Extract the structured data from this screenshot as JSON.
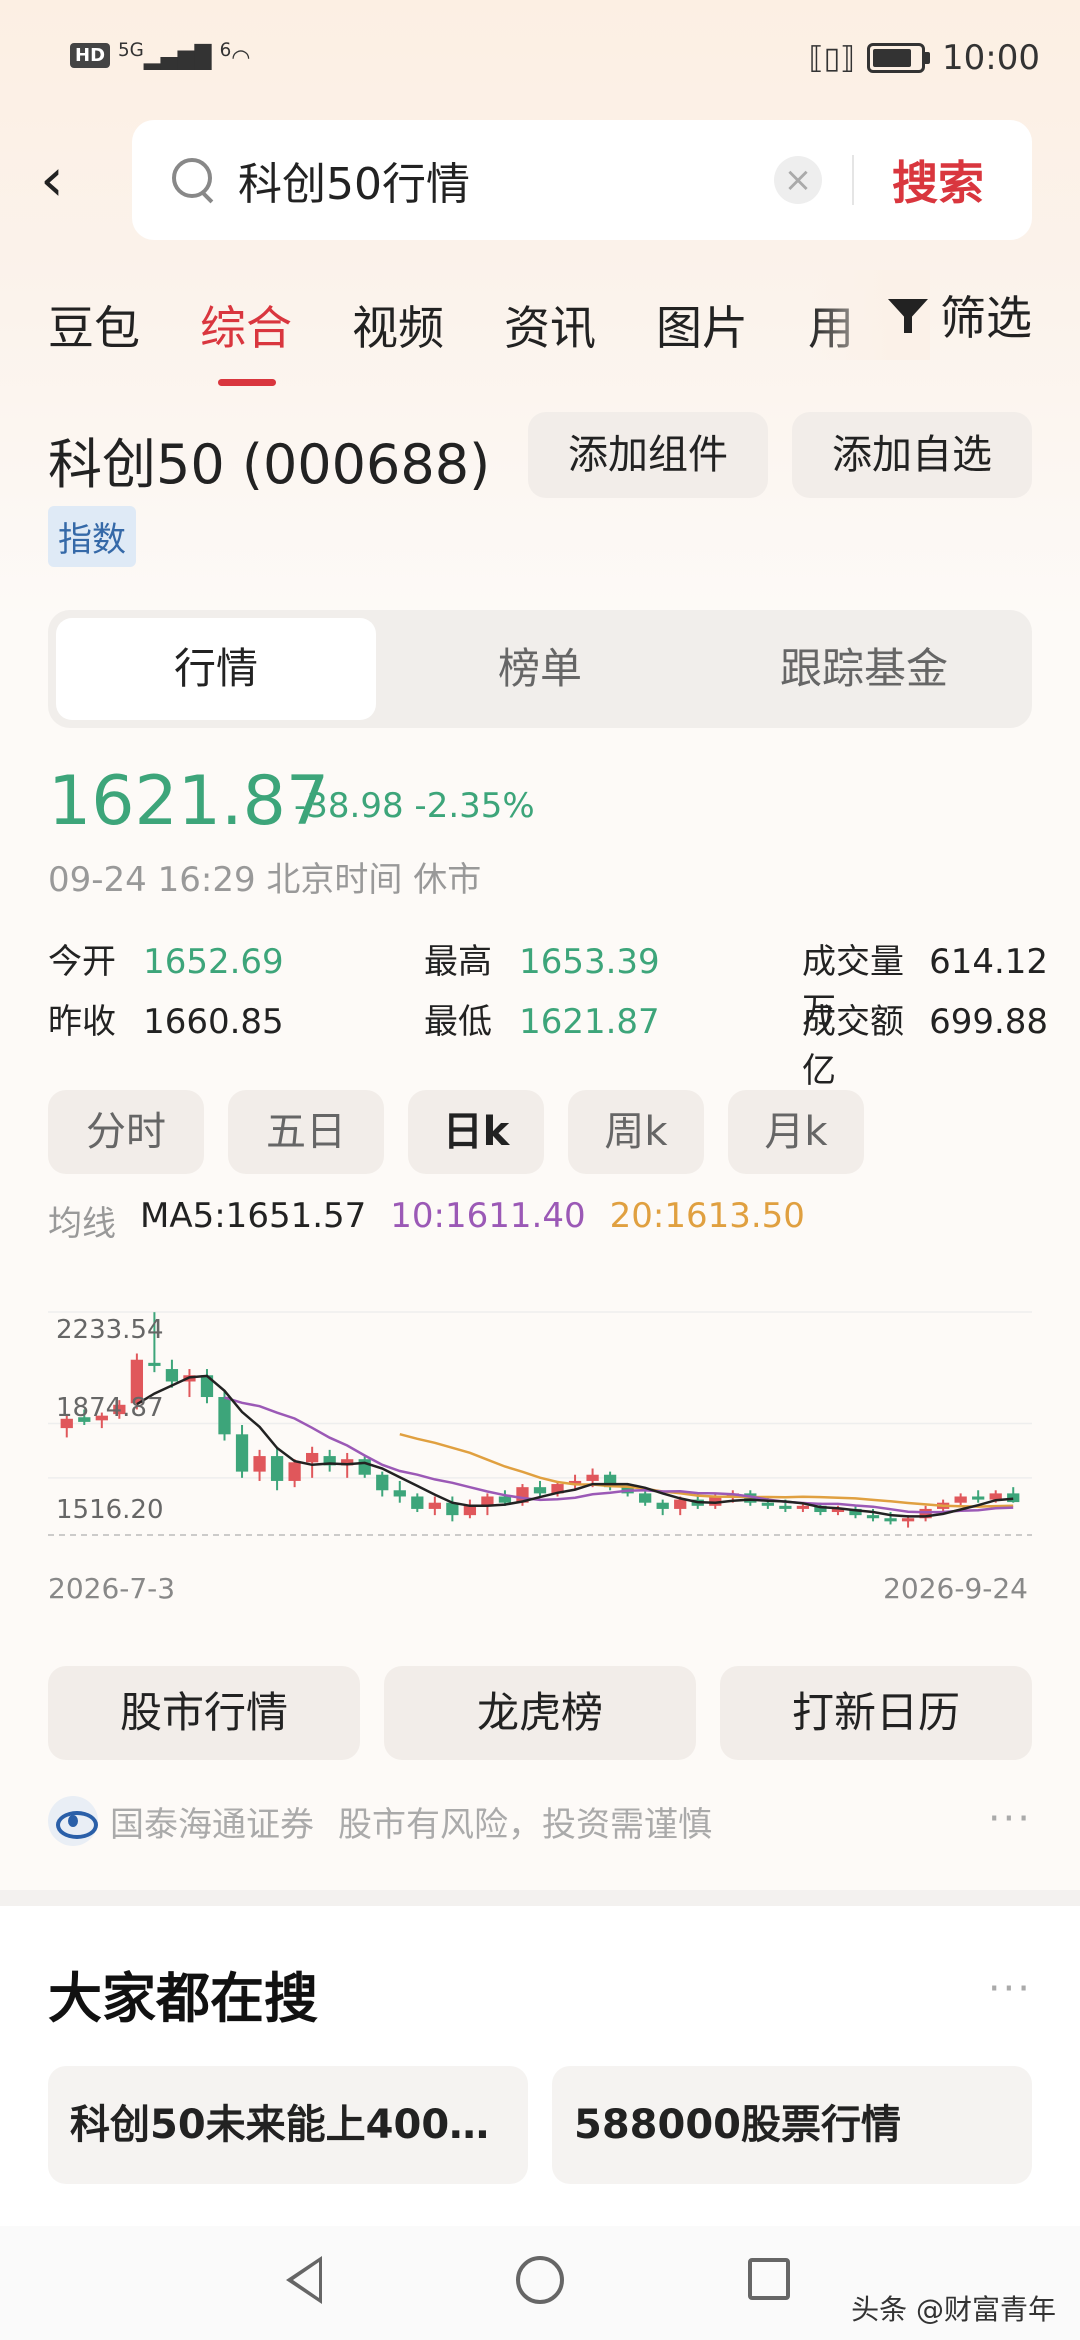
{
  "status_bar": {
    "hd": "HD",
    "signal": "5G",
    "wifi": "6",
    "time": "10:00"
  },
  "search": {
    "query": "科创50行情",
    "button": "搜索"
  },
  "tabs": [
    "豆包",
    "综合",
    "视频",
    "资讯",
    "图片",
    "用"
  ],
  "filter_label": "筛选",
  "stock": {
    "title": "科创50 (000688)",
    "tag": "指数",
    "add_widget": "添加组件",
    "add_watch": "添加自选"
  },
  "segments": [
    "行情",
    "榜单",
    "跟踪基金"
  ],
  "quote": {
    "price": "1621.87",
    "change": "-38.98",
    "change_pct": "-2.35%",
    "time_info": "09-24 16:29 北京时间 休市"
  },
  "stats": {
    "open_label": "今开",
    "open": "1652.69",
    "high_label": "最高",
    "high": "1653.39",
    "volume_label": "成交量",
    "volume": "614.12万",
    "prev_close_label": "昨收",
    "prev_close": "1660.85",
    "low_label": "最低",
    "low": "1621.87",
    "amount_label": "成交额",
    "amount": "699.88亿"
  },
  "periods": [
    "分时",
    "五日",
    "日k",
    "周k",
    "月k"
  ],
  "ma": {
    "label": "均线",
    "ma5": "MA5:1651.57",
    "ma10": "10:1611.40",
    "ma20": "20:1613.50",
    "colors": {
      "ma5": "#222222",
      "ma10": "#9b59b6",
      "ma20": "#e0a040"
    }
  },
  "chart_data": {
    "type": "candlestick",
    "y_ticks": [
      "2233.54",
      "1874.87",
      "1516.20"
    ],
    "x_start": "2026-7-3",
    "x_end": "2026-9-24",
    "ylim": [
      1516.2,
      2233.54
    ],
    "up_color": "#e0575b",
    "down_color": "#3da57a",
    "candles": [
      [
        1860,
        1905,
        1830,
        1890
      ],
      [
        1895,
        1920,
        1870,
        1880
      ],
      [
        1885,
        1910,
        1860,
        1900
      ],
      [
        1905,
        1950,
        1890,
        1935
      ],
      [
        1940,
        2100,
        1920,
        2080
      ],
      [
        2070,
        2233,
        2040,
        2060
      ],
      [
        2050,
        2080,
        1990,
        2010
      ],
      [
        2010,
        2050,
        1960,
        2030
      ],
      [
        2030,
        2050,
        1940,
        1960
      ],
      [
        1960,
        1980,
        1820,
        1840
      ],
      [
        1840,
        1870,
        1700,
        1720
      ],
      [
        1720,
        1790,
        1690,
        1770
      ],
      [
        1770,
        1800,
        1660,
        1690
      ],
      [
        1690,
        1760,
        1670,
        1750
      ],
      [
        1750,
        1800,
        1700,
        1780
      ],
      [
        1770,
        1790,
        1720,
        1740
      ],
      [
        1740,
        1780,
        1700,
        1760
      ],
      [
        1760,
        1770,
        1700,
        1710
      ],
      [
        1710,
        1720,
        1640,
        1660
      ],
      [
        1660,
        1690,
        1620,
        1640
      ],
      [
        1640,
        1650,
        1590,
        1600
      ],
      [
        1600,
        1640,
        1580,
        1620
      ],
      [
        1620,
        1640,
        1560,
        1580
      ],
      [
        1580,
        1630,
        1570,
        1610
      ],
      [
        1610,
        1650,
        1580,
        1640
      ],
      [
        1640,
        1660,
        1610,
        1620
      ],
      [
        1620,
        1680,
        1610,
        1670
      ],
      [
        1670,
        1690,
        1640,
        1650
      ],
      [
        1650,
        1690,
        1640,
        1680
      ],
      [
        1680,
        1710,
        1660,
        1690
      ],
      [
        1690,
        1730,
        1670,
        1710
      ],
      [
        1710,
        1720,
        1660,
        1670
      ],
      [
        1670,
        1680,
        1640,
        1650
      ],
      [
        1650,
        1670,
        1610,
        1620
      ],
      [
        1620,
        1630,
        1580,
        1600
      ],
      [
        1600,
        1640,
        1580,
        1630
      ],
      [
        1630,
        1650,
        1600,
        1610
      ],
      [
        1610,
        1650,
        1600,
        1640
      ],
      [
        1640,
        1660,
        1620,
        1650
      ],
      [
        1650,
        1660,
        1610,
        1620
      ],
      [
        1620,
        1640,
        1600,
        1610
      ],
      [
        1610,
        1630,
        1590,
        1600
      ],
      [
        1600,
        1620,
        1590,
        1610
      ],
      [
        1610,
        1620,
        1580,
        1590
      ],
      [
        1590,
        1610,
        1580,
        1600
      ],
      [
        1600,
        1610,
        1570,
        1580
      ],
      [
        1580,
        1600,
        1560,
        1570
      ],
      [
        1570,
        1590,
        1550,
        1560
      ],
      [
        1560,
        1580,
        1540,
        1570
      ],
      [
        1570,
        1610,
        1560,
        1600
      ],
      [
        1600,
        1630,
        1590,
        1620
      ],
      [
        1620,
        1650,
        1610,
        1640
      ],
      [
        1640,
        1660,
        1620,
        1630
      ],
      [
        1630,
        1660,
        1620,
        1650
      ],
      [
        1650,
        1670,
        1620,
        1622
      ]
    ]
  },
  "quick_buttons": [
    "股市行情",
    "龙虎榜",
    "打新日历"
  ],
  "ad": {
    "sponsor": "国泰海通证券",
    "disclaimer": "股市有风险，投资需谨慎"
  },
  "popular": {
    "title": "大家都在搜",
    "items": [
      "科创50未来能上4000...",
      "588000股票行情"
    ]
  },
  "watermark": "头条 @财富青年"
}
